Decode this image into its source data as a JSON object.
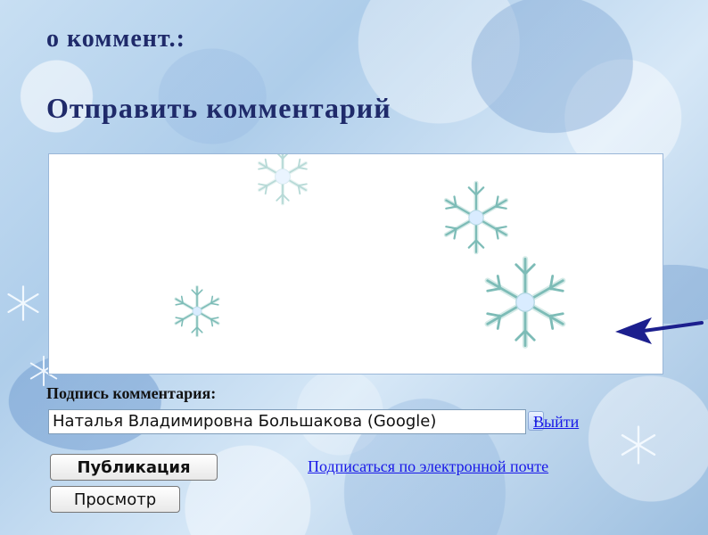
{
  "heading": {
    "comments_suffix": "о коммент.:",
    "post_comment": "Отправить комментарий"
  },
  "comment_form": {
    "signature_label": "Подпись комментария:",
    "identity_value": "Наталья Владимировна Большакова (Google)",
    "logout_link": "Выйти",
    "publish_button": "Публикация",
    "preview_button": "Просмотр",
    "subscribe_link": "Подписаться по электронной почте"
  },
  "icons": {
    "dropdown": "chevron-down-icon",
    "arrow": "arrow-left-icon",
    "snowflake": "snowflake-icon"
  },
  "colors": {
    "heading": "#1f2a6a",
    "link": "#1818e8",
    "arrow": "#1c1f8e"
  }
}
